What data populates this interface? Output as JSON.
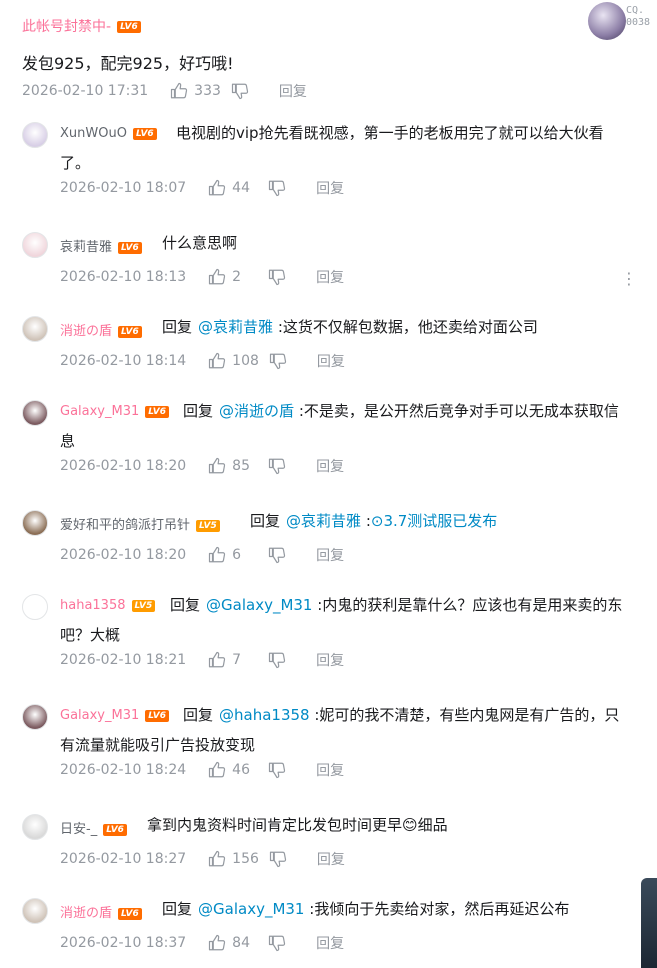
{
  "top": {
    "username": "此帐号封禁中-",
    "level": "LV6",
    "text": "发包925，配完925，好巧哦!",
    "time": "2026-02-10 17:31",
    "likes": "333",
    "reply_label": "回复",
    "corner_tag": "CQ.\n0038"
  },
  "colors": {
    "username_pink": "#fb7299",
    "mention_blue": "#008ac5",
    "meta_gray": "#9499a0",
    "level_orange": "#ff6c00"
  },
  "replies": [
    {
      "username": "XunWOuO",
      "level": "LV6",
      "prefix": "",
      "mention": "",
      "text_line1": "电视剧的vip抢先看既视感，第一手的老板用完了就可以给大伙看",
      "text_line2": "了。",
      "time": "2026-02-10 18:07",
      "likes": "44",
      "reply_label": "回复"
    },
    {
      "username": "哀莉昔雅",
      "level": "LV6",
      "prefix": "",
      "mention": "",
      "text_line1": "什么意思啊",
      "text_line2": "",
      "time": "2026-02-10 18:13",
      "likes": "2",
      "reply_label": "回复"
    },
    {
      "username": "消逝の盾",
      "level": "LV6",
      "prefix": "回复",
      "mention": "@哀莉昔雅",
      "text_line1": ":这货不仅解包数据，他还卖给对面公司",
      "text_line2": "",
      "time": "2026-02-10 18:14",
      "likes": "108",
      "reply_label": "回复"
    },
    {
      "username": "Galaxy_M31",
      "level": "LV6",
      "prefix": "回复",
      "mention": "@消逝の盾",
      "text_line1": ":不是卖，是公开然后竞争对手可以无成本获取信",
      "text_line2": "息",
      "time": "2026-02-10 18:20",
      "likes": "85",
      "reply_label": "回复"
    },
    {
      "username": "爱好和平的鸽派打吊针",
      "level": "LV5",
      "prefix": "回复",
      "mention": "@哀莉昔雅",
      "text_line1": ":",
      "link": "3.7测试服已发布",
      "text_line2": "",
      "time": "2026-02-10 18:20",
      "likes": "6",
      "reply_label": "回复"
    },
    {
      "username": "haha1358",
      "level": "LV5",
      "prefix": "回复",
      "mention": "@Galaxy_M31",
      "text_line1": ":内鬼的获利是靠什么？应该也有是用来卖的东",
      "text_line2": "吧？大概",
      "time": "2026-02-10 18:21",
      "likes": "7",
      "reply_label": "回复"
    },
    {
      "username": "Galaxy_M31",
      "level": "LV6",
      "prefix": "回复",
      "mention": "@haha1358",
      "text_line1": ":妮可的我不清楚，有些内鬼网是有广告的，只",
      "text_line2": "有流量就能吸引广告投放变现",
      "time": "2026-02-10 18:24",
      "likes": "46",
      "reply_label": "回复"
    },
    {
      "username": "日安-_",
      "level": "LV6",
      "prefix": "",
      "mention": "",
      "text_line1": "拿到内鬼资料时间肯定比发包时间更早",
      "emoji": "😊",
      "text_after_emoji": "细品",
      "text_line2": "",
      "time": "2026-02-10 18:27",
      "likes": "156",
      "reply_label": "回复"
    },
    {
      "username": "消逝の盾",
      "level": "LV6",
      "prefix": "回复",
      "mention": "@Galaxy_M31",
      "text_line1": ":我倾向于先卖给对家，然后再延迟公布",
      "text_line2": "",
      "time": "2026-02-10 18:37",
      "likes": "84",
      "reply_label": "回复"
    }
  ]
}
